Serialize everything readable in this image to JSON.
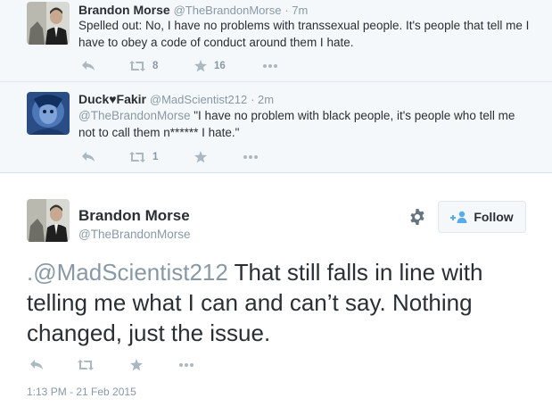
{
  "colors": {
    "context_bg": "#f5f8fa",
    "text": "#292f33",
    "muted": "#8899a6",
    "icon": "#aab8c2",
    "follow_icon": "#55acee"
  },
  "tweets": [
    {
      "name": "Brandon Morse",
      "screen_name": "@TheBrandonMorse",
      "time": "· 7m",
      "text": "Spelled out: No, I have no problems with transsexual people. It's people that tell me I have to obey a code of conduct around them I hate.",
      "retweets": "8",
      "favorites": "16",
      "icons": [
        "reply-icon",
        "retweet-icon",
        "favorite-icon",
        "more-icon"
      ]
    },
    {
      "name": "Duck♥Fakir",
      "screen_name": "@MadScientist212",
      "time": "· 2m",
      "mention": "@TheBrandonMorse",
      "text": " \"I have no problem with black people, it's people who tell me not to call them n****** I hate.\"",
      "retweets": "1",
      "icons": [
        "reply-icon",
        "retweet-icon",
        "favorite-icon",
        "more-icon"
      ]
    }
  ],
  "main": {
    "name": "Brandon Morse",
    "screen_name": "@TheBrandonMorse",
    "follow_label": "Follow",
    "text_prefix": ".",
    "mention": "@MadScientist212",
    "text": " That still falls in line with telling me what I can and can’t say. Nothing changed, just the issue.",
    "timestamp": "1:13 PM - 21 Feb 2015",
    "icons": [
      "reply-icon",
      "retweet-icon",
      "favorite-icon",
      "more-icon",
      "gear-icon",
      "follow-user-icon"
    ]
  }
}
